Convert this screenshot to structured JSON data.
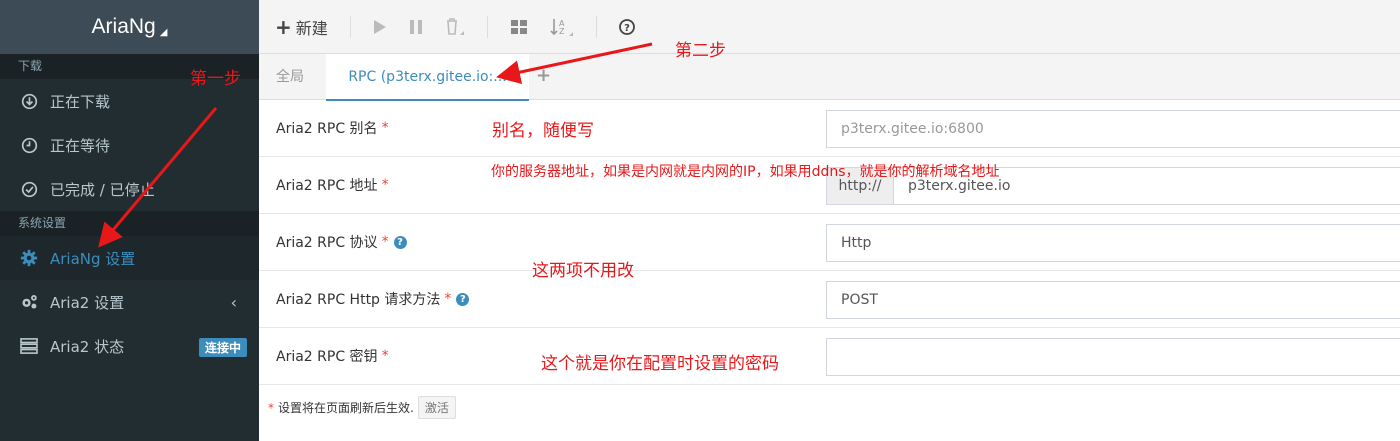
{
  "app": {
    "brand": "AriaNg"
  },
  "sidebar": {
    "section_downloads": "下载",
    "downloads": [
      {
        "label": "正在下载",
        "icon": "download-circle-icon"
      },
      {
        "label": "正在等待",
        "icon": "clock-icon"
      },
      {
        "label": "已完成 / 已停止",
        "icon": "check-circle-icon"
      }
    ],
    "section_settings": "系统设置",
    "settings": [
      {
        "label": "AriaNg 设置",
        "icon": "gear-icon",
        "active": true
      },
      {
        "label": "Aria2 设置",
        "icon": "gears-icon"
      },
      {
        "label": "Aria2 状态",
        "icon": "server-icon",
        "badge": "连接中"
      }
    ]
  },
  "toolbar": {
    "new_label": "新建"
  },
  "tabs": {
    "global": "全局",
    "rpc": "RPC (p3terx.gitee.io:..."
  },
  "form": {
    "alias": {
      "label": "Aria2 RPC 别名",
      "placeholder": "p3terx.gitee.io:6800"
    },
    "address": {
      "label": "Aria2 RPC 地址",
      "prefix": "http://",
      "value": "p3terx.gitee.io"
    },
    "protocol": {
      "label": "Aria2 RPC 协议",
      "value": "Http"
    },
    "method": {
      "label": "Aria2 RPC Http 请求方法",
      "value": "POST"
    },
    "secret": {
      "label": "Aria2 RPC 密钥",
      "value": ""
    }
  },
  "footer": {
    "note": "设置将在页面刷新后生效.",
    "activate": "激活"
  },
  "annotations": {
    "step1": "第一步",
    "step2": "第二步",
    "alias_hint": "别名，随便写",
    "address_hint": "你的服务器地址，如果是内网就是内网的IP，如果用ddns，就是你的解析域名地址",
    "no_change_hint": "这两项不用改",
    "secret_hint": "这个就是你在配置时设置的密码"
  },
  "colors": {
    "accent": "#3c8dbc",
    "sidebar": "#222d32",
    "annotation": "#e8171a"
  }
}
